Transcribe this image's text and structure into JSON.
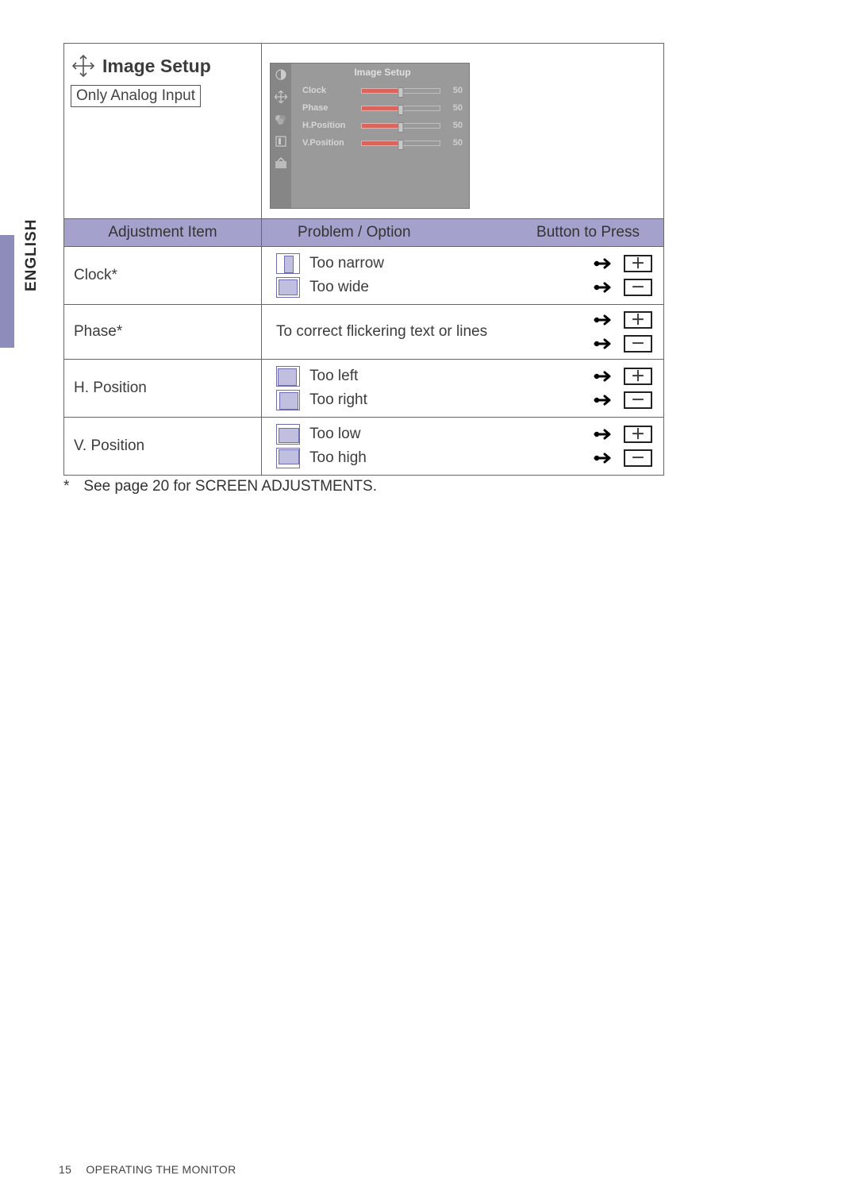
{
  "sideTab": "ENGLISH",
  "section": {
    "title": "Image Setup",
    "note": "Only Analog Input"
  },
  "osd": {
    "title": "Image Setup",
    "rows": [
      {
        "label": "Clock",
        "value": "50"
      },
      {
        "label": "Phase",
        "value": "50"
      },
      {
        "label": "H.Position",
        "value": "50"
      },
      {
        "label": "V.Position",
        "value": "50"
      }
    ]
  },
  "columns": {
    "adjustment": "Adjustment Item",
    "problem": "Problem / Option",
    "button": "Button to Press"
  },
  "rows": [
    {
      "item": "Clock*",
      "problems": [
        "Too narrow",
        "Too wide"
      ],
      "buttons": [
        "plus",
        "minus"
      ]
    },
    {
      "item": "Phase*",
      "problems": [
        "To correct flickering text or lines"
      ],
      "buttons": [
        "plus",
        "minus"
      ]
    },
    {
      "item": "H. Position",
      "problems": [
        "Too left",
        "Too right"
      ],
      "buttons": [
        "plus",
        "minus"
      ]
    },
    {
      "item": "V. Position",
      "problems": [
        "Too low",
        "Too high"
      ],
      "buttons": [
        "plus",
        "minus"
      ]
    }
  ],
  "footnote_mark": "*",
  "footnote": "See page 20 for SCREEN ADJUSTMENTS.",
  "footer": {
    "page": "15",
    "section": "OPERATING THE MONITOR"
  }
}
